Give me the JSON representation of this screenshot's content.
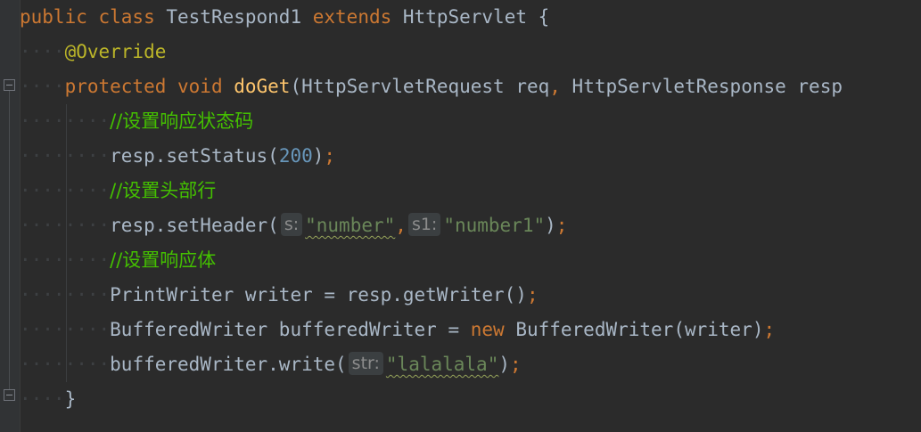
{
  "editor": {
    "lines": [
      {
        "indent": "",
        "guides": 0,
        "tokens": [
          {
            "t": "kw",
            "v": "public class "
          },
          {
            "t": "plain",
            "v": "TestRespond1 "
          },
          {
            "t": "kw",
            "v": "extends "
          },
          {
            "t": "plain",
            "v": "HttpServlet {"
          }
        ]
      },
      {
        "indent": "····",
        "guides": 0,
        "tokens": [
          {
            "t": "annotation",
            "v": "@Override"
          }
        ]
      },
      {
        "indent": "····",
        "guides": 0,
        "tokens": [
          {
            "t": "kw",
            "v": "protected void "
          },
          {
            "t": "method",
            "v": "doGet"
          },
          {
            "t": "plain",
            "v": "(HttpServletRequest req"
          },
          {
            "t": "semi",
            "v": ", "
          },
          {
            "t": "plain",
            "v": "HttpServletResponse resp"
          }
        ]
      },
      {
        "indent": "········",
        "guides": 1,
        "tokens": [
          {
            "t": "comment",
            "v": "//设置响应状态码"
          }
        ]
      },
      {
        "indent": "········",
        "guides": 1,
        "tokens": [
          {
            "t": "plain",
            "v": "resp.setStatus("
          },
          {
            "t": "number",
            "v": "200"
          },
          {
            "t": "plain",
            "v": ")"
          },
          {
            "t": "semi",
            "v": ";"
          }
        ]
      },
      {
        "indent": "········",
        "guides": 1,
        "tokens": [
          {
            "t": "comment",
            "v": "//设置头部行"
          }
        ]
      },
      {
        "indent": "········",
        "guides": 1,
        "tokens": [
          {
            "t": "plain",
            "v": "resp.setHeader("
          },
          {
            "t": "hint",
            "v": "s:"
          },
          {
            "t": "string-sq",
            "v": "\"number\""
          },
          {
            "t": "semi",
            "v": ","
          },
          {
            "t": "hint",
            "v": "s1:"
          },
          {
            "t": "string",
            "v": "\"number1\""
          },
          {
            "t": "plain",
            "v": ")"
          },
          {
            "t": "semi",
            "v": ";"
          }
        ]
      },
      {
        "indent": "········",
        "guides": 1,
        "tokens": [
          {
            "t": "comment",
            "v": "//设置响应体"
          }
        ]
      },
      {
        "indent": "········",
        "guides": 1,
        "tokens": [
          {
            "t": "plain",
            "v": "PrintWriter writer = resp.getWriter()"
          },
          {
            "t": "semi",
            "v": ";"
          }
        ]
      },
      {
        "indent": "········",
        "guides": 1,
        "tokens": [
          {
            "t": "plain",
            "v": "BufferedWriter bufferedWriter = "
          },
          {
            "t": "kw",
            "v": "new "
          },
          {
            "t": "plain",
            "v": "BufferedWriter(writer)"
          },
          {
            "t": "semi",
            "v": ";"
          }
        ]
      },
      {
        "indent": "········",
        "guides": 1,
        "tokens": [
          {
            "t": "plain",
            "v": "bufferedWriter.write("
          },
          {
            "t": "hint",
            "v": "str:"
          },
          {
            "t": "string-sq",
            "v": "\"lalalala\""
          },
          {
            "t": "plain",
            "v": ")"
          },
          {
            "t": "semi",
            "v": ";"
          }
        ]
      },
      {
        "indent": "····",
        "guides": 0,
        "tokens": [
          {
            "t": "plain",
            "v": "}"
          }
        ]
      }
    ]
  }
}
